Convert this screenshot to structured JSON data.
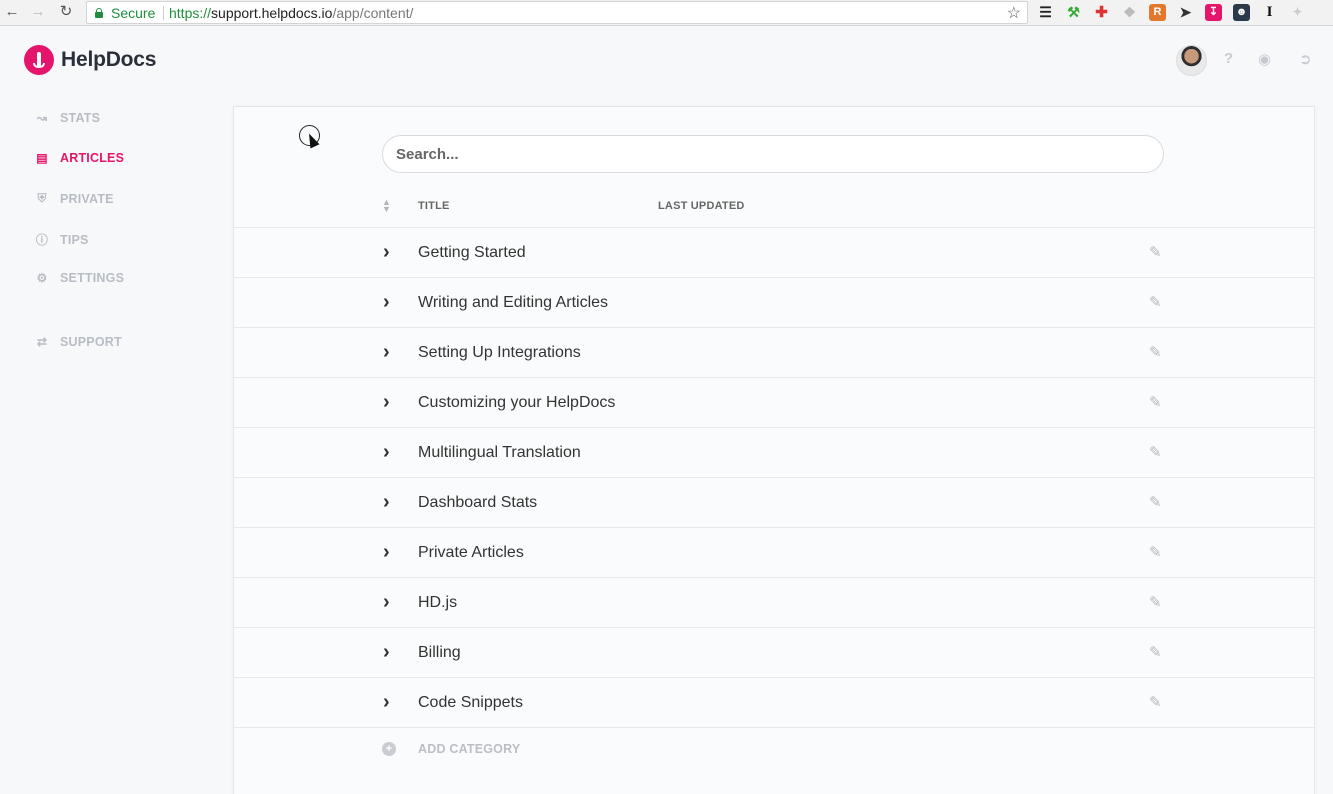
{
  "browser": {
    "secure_label": "Secure",
    "url_scheme": "https://",
    "url_host": "support.helpdocs.io",
    "url_path": "/app/content/",
    "extensions": [
      "layers-icon",
      "tool-icon",
      "medical-cross-icon",
      "puzzle-icon",
      "r-extension-icon",
      "rocket-icon",
      "pocket-icon",
      "robot-icon",
      "i-extension-icon",
      "bird-icon"
    ]
  },
  "brand": {
    "name": "HelpDocs",
    "accent_color": "#e5156b"
  },
  "header": {
    "help_icon": "question-icon",
    "preview_icon": "eye-icon",
    "logout_icon": "sign-out-icon"
  },
  "sidebar": {
    "items": [
      {
        "label": "STATS",
        "icon": "line-chart-icon",
        "active": false
      },
      {
        "label": "ARTICLES",
        "icon": "document-icon",
        "active": true
      },
      {
        "label": "PRIVATE",
        "icon": "shield-icon",
        "active": false
      },
      {
        "label": "TIPS",
        "icon": "info-icon",
        "active": false
      },
      {
        "label": "SETTINGS",
        "icon": "gear-icon",
        "active": false
      },
      {
        "label": "SUPPORT",
        "icon": "shuffle-icon",
        "active": false
      }
    ]
  },
  "main": {
    "search_placeholder": "Search...",
    "columns": {
      "title": "TITLE",
      "last_updated": "LAST UPDATED"
    },
    "categories": [
      "Getting Started",
      "Writing and Editing Articles",
      "Setting Up Integrations",
      "Customizing your HelpDocs",
      "Multilingual Translation",
      "Dashboard Stats",
      "Private Articles",
      "HD.js",
      "Billing",
      "Code Snippets"
    ],
    "add_category_label": "ADD CATEGORY"
  }
}
